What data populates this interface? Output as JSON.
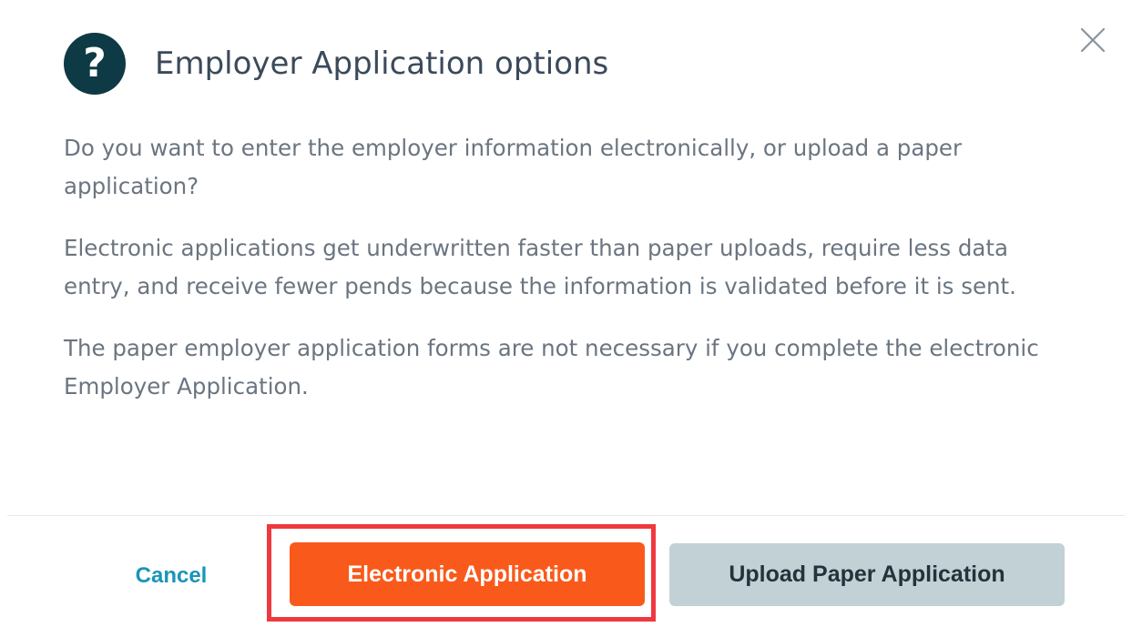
{
  "dialog": {
    "help_icon_glyph": "?",
    "title": "Employer Application options",
    "paragraphs": {
      "p1": "Do you want to enter the employer information electronically, or upload a paper application?",
      "p2": "Electronic applications get underwritten faster than paper uploads, require less data entry, and receive fewer pends because the information is validated before it is sent.",
      "p3": "The paper employer application forms are not necessary if you complete the electronic Employer Application."
    }
  },
  "footer": {
    "cancel_label": "Cancel",
    "electronic_label": "Electronic Application",
    "upload_label": "Upload Paper Application"
  },
  "icons": {
    "help": "question-circle-icon",
    "close": "close-icon"
  },
  "colors": {
    "primary_button": "#f95a1b",
    "secondary_button": "#c2d1d5",
    "link": "#1a95b7",
    "highlight_border": "#f0383f",
    "help_icon_bg": "#0e3a45"
  }
}
